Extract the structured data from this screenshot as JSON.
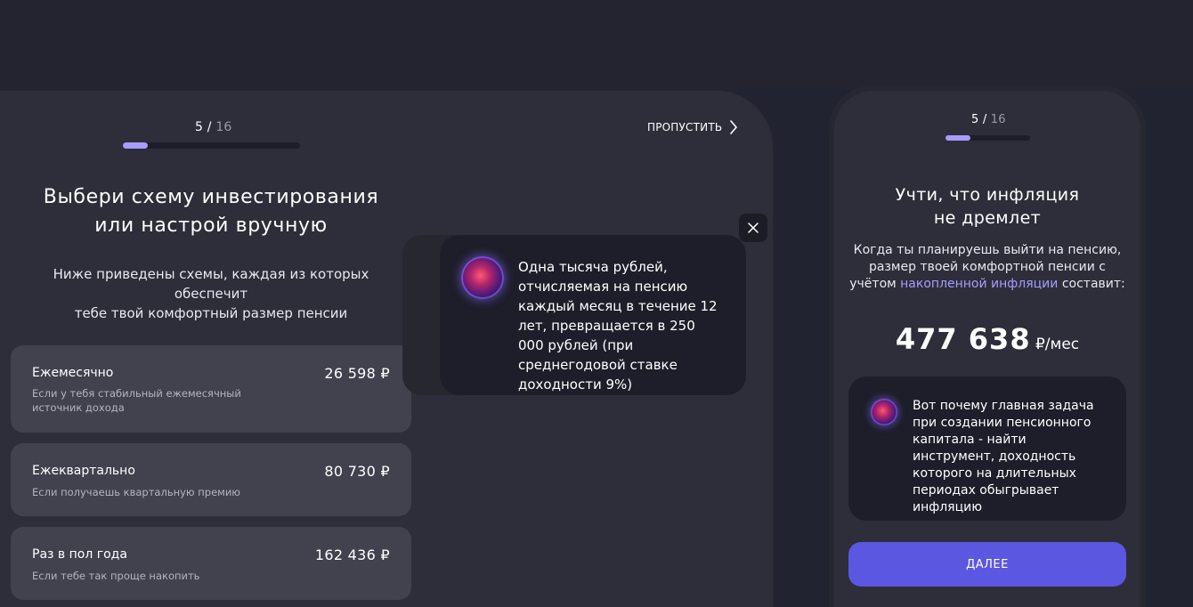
{
  "colors": {
    "background": "#222330",
    "panel": "#2d2e3a",
    "card": "#41424e",
    "tooltip": "#1d1e29",
    "accent": "#a79cff",
    "button": "#5b57e0"
  },
  "left": {
    "progress": {
      "current": "5",
      "separator": " / ",
      "total": "16",
      "fraction": 0.14
    },
    "skip_label": "ПРОПУСТИТЬ",
    "title_line1": "Выбери схему инвестирования",
    "title_line2": "или настрой вручную",
    "subtitle_line1": "Ниже приведены схемы, каждая из которых обеспечит",
    "subtitle_line2": "тебе твой комфортный размер пенсии",
    "schemes": [
      {
        "name": "Ежемесячно",
        "description": "Если у тебя стабильный ежемесячный источник дохода",
        "amount": "26 598 ₽"
      },
      {
        "name": "Ежеквартально",
        "description": "Если получаешь квартальную премию",
        "amount": "80 730 ₽"
      },
      {
        "name": "Раз в пол года",
        "description": "Если тебе так проще накопить",
        "amount": "162 436 ₽"
      }
    ],
    "tooltip_text": "Одна тысяча рублей, отчисляемая на пенсию каждый месяц в течение 12 лет, превращается в 250 000 рублей (при среднегодовой ставке доходности 9%)",
    "close_icon": "close-icon"
  },
  "right": {
    "progress": {
      "current": "5",
      "separator": " / ",
      "total": "16",
      "fraction": 0.29
    },
    "title_line1": "Учти, что инфляция",
    "title_line2": "не дремлет",
    "subtitle_part1": "Когда ты планируешь выйти на пенсию, размер твоей комфортной пенсии с учётом ",
    "subtitle_link": "накопленной инфляции",
    "subtitle_part2": " составит:",
    "amount": "477 638",
    "amount_unit": " ₽/мес",
    "info_text": "Вот почему главная задача при создании пенсионного капитала - найти инструмент, доходность которого на длительных периодах обыгрывает инфляцию",
    "next_label": "ДАЛЕЕ"
  }
}
